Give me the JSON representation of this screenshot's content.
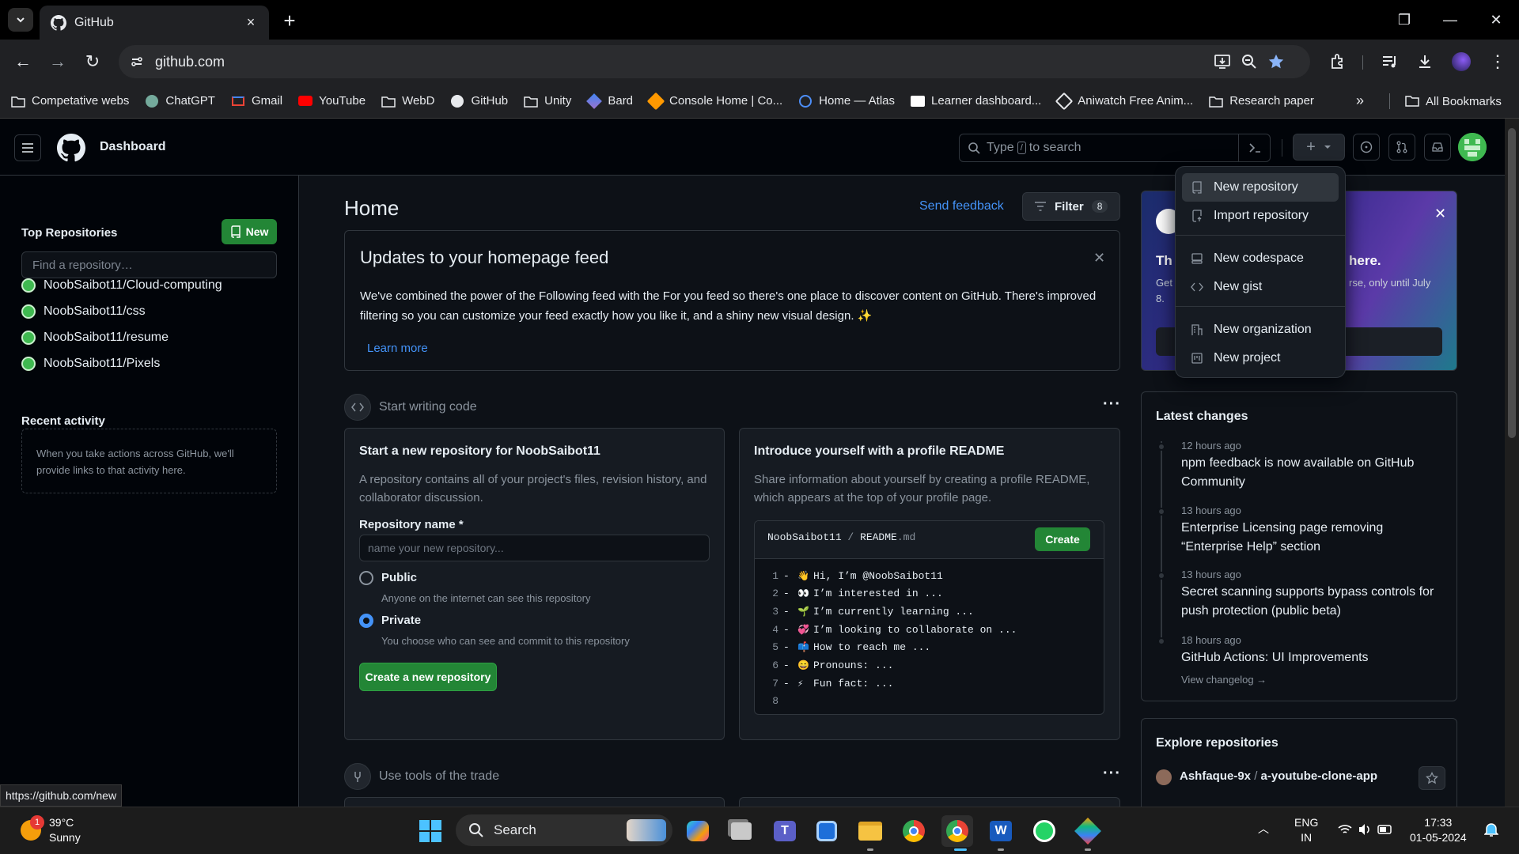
{
  "browser": {
    "tab_title": "GitHub",
    "url": "github.com",
    "bookmarks": [
      {
        "label": "Competative webs",
        "icon": "folder-icon"
      },
      {
        "label": "ChatGPT",
        "icon": "chatgpt-icon"
      },
      {
        "label": "Gmail",
        "icon": "gmail-icon"
      },
      {
        "label": "YouTube",
        "icon": "youtube-icon"
      },
      {
        "label": "WebD",
        "icon": "folder-icon"
      },
      {
        "label": "GitHub",
        "icon": "github-icon"
      },
      {
        "label": "Unity",
        "icon": "folder-icon"
      },
      {
        "label": "Bard",
        "icon": "bard-icon"
      },
      {
        "label": "Console Home | Co...",
        "icon": "aws-icon"
      },
      {
        "label": "Home — Atlas",
        "icon": "atlas-icon"
      },
      {
        "label": "Learner dashboard...",
        "icon": "aws-learner-icon"
      },
      {
        "label": "Aniwatch Free Anim...",
        "icon": "aniwatch-icon"
      },
      {
        "label": "Research paper",
        "icon": "folder-icon"
      }
    ],
    "all_bookmarks": "All Bookmarks",
    "status_url": "https://github.com/new"
  },
  "header": {
    "title": "Dashboard",
    "search_placeholder_pre": "Type",
    "search_key": "/",
    "search_placeholder_post": "to search"
  },
  "create_menu": {
    "items": [
      {
        "label": "New repository",
        "icon": "repo-icon"
      },
      {
        "label": "Import repository",
        "icon": "repo-push-icon"
      },
      {
        "label": "New codespace",
        "icon": "codespaces-icon"
      },
      {
        "label": "New gist",
        "icon": "code-icon"
      },
      {
        "label": "New organization",
        "icon": "organization-icon"
      },
      {
        "label": "New project",
        "icon": "project-icon"
      }
    ]
  },
  "sidebar": {
    "top_repos_title": "Top Repositories",
    "new_button": "New",
    "find_placeholder": "Find a repository…",
    "repos": [
      "NoobSaibot11/Cloud-computing",
      "NoobSaibot11/css",
      "NoobSaibot11/resume",
      "NoobSaibot11/Pixels"
    ],
    "recent_title": "Recent activity",
    "recent_empty": "When you take actions across GitHub, we'll provide links to that activity here."
  },
  "main": {
    "title": "Home",
    "send_feedback": "Send feedback",
    "filter_label": "Filter",
    "filter_count": "8",
    "update": {
      "title": "Updates to your homepage feed",
      "body": "We've combined the power of the Following feed with the For you feed so there's one place to discover content on GitHub. There's improved filtering so you can customize your feed exactly how you like it, and a shiny new visual design. ✨",
      "link": "Learn more"
    },
    "start_writing": "Start writing code",
    "new_repo_card": {
      "title": "Start a new repository for NoobSaibot11",
      "desc": "A repository contains all of your project's files, revision history, and collaborator discussion.",
      "name_label": "Repository name *",
      "name_placeholder": "name your new repository...",
      "public_label": "Public",
      "public_desc": "Anyone on the internet can see this repository",
      "private_label": "Private",
      "private_desc": "You choose who can see and commit to this repository",
      "create_button": "Create a new repository"
    },
    "readme_card": {
      "title": "Introduce yourself with a profile README",
      "desc": "Share information about yourself by creating a profile README, which appears at the top of your profile page.",
      "path_user": "NoobSaibot11",
      "path_sep": " / ",
      "path_file": "README",
      "path_ext": ".md",
      "create_button": "Create",
      "lines": [
        {
          "n": "1",
          "emoji": "👋",
          "text": "Hi, I’m @NoobSaibot11"
        },
        {
          "n": "2",
          "emoji": "👀",
          "text": "I’m interested in ..."
        },
        {
          "n": "3",
          "emoji": "🌱",
          "text": "I’m currently learning ..."
        },
        {
          "n": "4",
          "emoji": "💞️",
          "text": "I’m looking to collaborate on ..."
        },
        {
          "n": "5",
          "emoji": "📫",
          "text": "How to reach me ..."
        },
        {
          "n": "6",
          "emoji": "😄",
          "text": "Pronouns: ..."
        },
        {
          "n": "7",
          "emoji": "⚡",
          "text": "Fun fact: ..."
        },
        {
          "n": "8",
          "emoji": "",
          "text": ""
        }
      ]
    },
    "use_tools": "Use tools of the trade"
  },
  "promo": {
    "title_left": "Th",
    "title_right": "here.",
    "sub_left": "Get",
    "sub_right": "rse, only until July",
    "sub_line2": "8."
  },
  "latest_changes": {
    "title": "Latest changes",
    "items": [
      {
        "time": "12 hours ago",
        "text": "npm feedback is now available on GitHub Community"
      },
      {
        "time": "13 hours ago",
        "text": "Enterprise Licensing page removing “Enterprise Help” section"
      },
      {
        "time": "13 hours ago",
        "text": "Secret scanning supports bypass controls for push protection (public beta)"
      },
      {
        "time": "18 hours ago",
        "text": "GitHub Actions: UI Improvements"
      }
    ],
    "view_changelog": "View changelog →"
  },
  "explore": {
    "title": "Explore repositories",
    "owner": "Ashfaque-9x",
    "sep": " / ",
    "repo": "a-youtube-clone-app"
  },
  "taskbar": {
    "temp": "39°C",
    "condition": "Sunny",
    "badge": "1",
    "search": "Search",
    "lang1": "ENG",
    "lang2": "IN",
    "time": "17:33",
    "date": "01-05-2024"
  },
  "colors": {
    "accent_green": "#238636",
    "link_blue": "#4493f8",
    "bg": "#0d1117"
  }
}
